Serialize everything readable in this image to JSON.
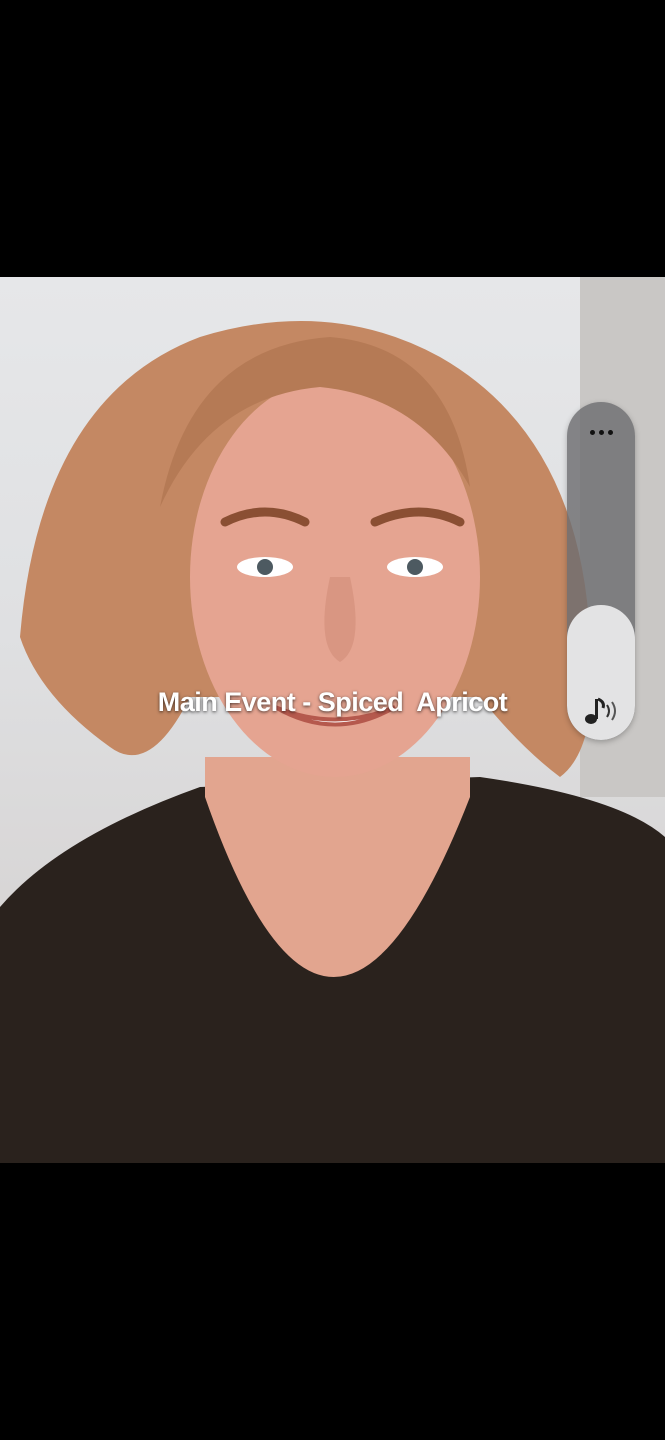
{
  "caption": "Main Event - Spiced  Apricot",
  "volume_panel": {
    "more_icon": "more-horizontal-icon",
    "media_icon": "music-note-volume-icon",
    "level": 0.4
  },
  "colors": {
    "background": "#000000",
    "panel": "#6e6e70",
    "panel_fill": "#e3e3e4"
  }
}
